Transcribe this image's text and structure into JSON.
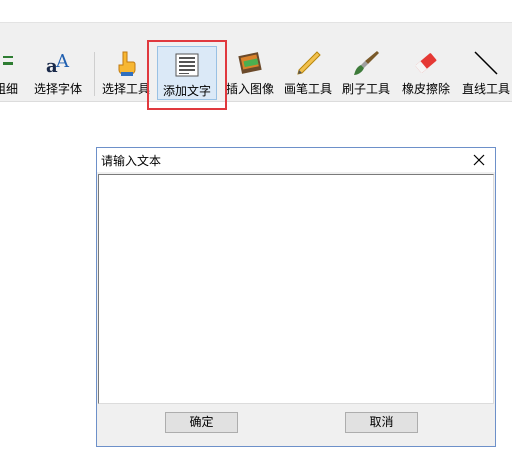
{
  "toolbar": {
    "items": [
      {
        "label": "粗细",
        "icon": "line-weight-icon"
      },
      {
        "label": "选择字体",
        "icon": "font-icon"
      },
      {
        "label": "选择工具",
        "icon": "pointer-hand-icon"
      },
      {
        "label": "添加文字",
        "icon": "text-block-icon",
        "selected": true
      },
      {
        "label": "插入图像",
        "icon": "picture-icon"
      },
      {
        "label": "画笔工具",
        "icon": "pencil-icon"
      },
      {
        "label": "刷子工具",
        "icon": "brush-icon"
      },
      {
        "label": "橡皮擦除",
        "icon": "eraser-icon"
      },
      {
        "label": "直线工具",
        "icon": "line-icon"
      }
    ],
    "highlight_color": "#e0393e"
  },
  "dialog": {
    "title": "请输入文本",
    "text_value": "",
    "ok_label": "确定",
    "cancel_label": "取消",
    "border_color": "#6d90c9"
  }
}
